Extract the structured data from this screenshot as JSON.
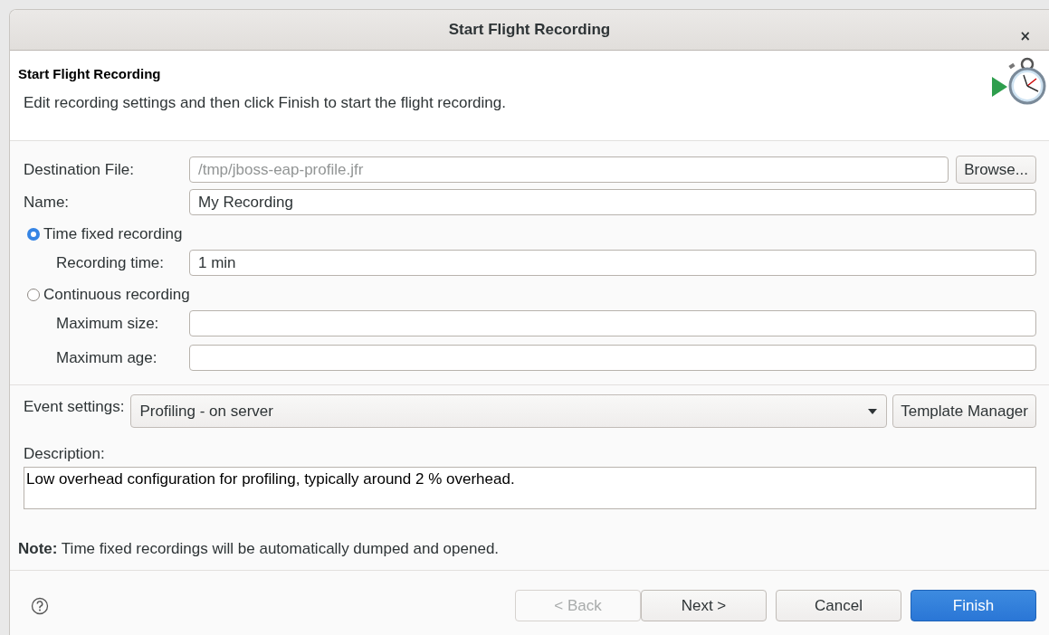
{
  "window": {
    "title": "Start Flight Recording",
    "close": "×"
  },
  "header": {
    "title": "Start Flight Recording",
    "message": "Edit recording settings and then click Finish to start the flight recording."
  },
  "fields": [
    {
      "label": "Destination File:",
      "value": "/tmp/jboss-eap-profile.jfr",
      "disabled": true,
      "button": "Browse..."
    },
    {
      "label": "Name:",
      "value": "My Recording",
      "disabled": false
    }
  ],
  "recording_modes": [
    {
      "label": "Time fixed recording",
      "selected": true,
      "fields": [
        {
          "label": "Recording time:",
          "value": "1 min"
        }
      ]
    },
    {
      "label": "Continuous recording",
      "selected": false,
      "fields": [
        {
          "label": "Maximum size:"
        },
        {
          "label": "Maximum age:"
        }
      ]
    }
  ],
  "event_settings": {
    "label": "Event settings:",
    "value": "Profiling - on server",
    "button": "Template Manager"
  },
  "description": {
    "label": "Description:",
    "text": "Low overhead configuration for profiling, typically around 2 % overhead."
  },
  "note": "**Note:** Time fixed recordings will be automatically dumped and opened.",
  "buttons": [
    {
      "label": "< Back",
      "disabled": true,
      "default": false
    },
    {
      "label": "Next >",
      "disabled": false,
      "default": false
    },
    {
      "label": "Cancel",
      "disabled": false,
      "default": false
    },
    {
      "label": "Finish",
      "disabled": false,
      "default": true
    }
  ]
}
